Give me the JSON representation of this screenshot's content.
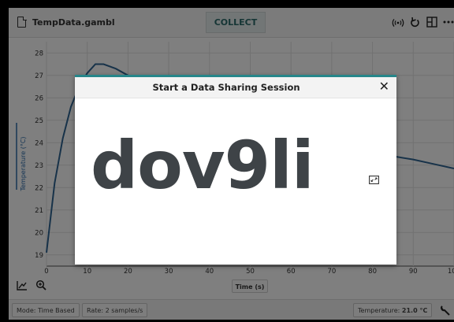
{
  "toolbar": {
    "file_name": "TempData.gambl",
    "collect_label": "COLLECT",
    "icons": [
      "file-icon",
      "wireless-icon",
      "undo-icon",
      "layout-icon",
      "more-icon"
    ]
  },
  "graph": {
    "xlabel": "Time (s)",
    "ylabel": "Temperature (°C)",
    "x_ticks": [
      "0",
      "10",
      "20",
      "30",
      "40",
      "50",
      "60",
      "70",
      "80",
      "90",
      "100"
    ],
    "y_ticks": [
      "19",
      "20",
      "21",
      "22",
      "23",
      "24",
      "25",
      "26",
      "27",
      "28"
    ],
    "line_color": "#2f6493"
  },
  "chart_data": {
    "type": "line",
    "title": "",
    "xlabel": "Time (s)",
    "ylabel": "Temperature (°C)",
    "xlim": [
      0,
      100
    ],
    "ylim": [
      18.5,
      28.5
    ],
    "grid": true,
    "series": [
      {
        "x": [
          0,
          2,
          4,
          6,
          8,
          10,
          12,
          14,
          17,
          20,
          85,
          90,
          95,
          100
        ],
        "y": [
          19.1,
          22.2,
          24.2,
          25.6,
          26.5,
          27.1,
          27.5,
          27.5,
          27.3,
          27.0,
          23.4,
          23.25,
          23.05,
          22.85
        ]
      }
    ]
  },
  "bottom": {
    "time_axis_label": "Time (s)",
    "icons": [
      "graph-tools-icon",
      "zoom-icon"
    ]
  },
  "status": {
    "mode_text": "Mode: Time Based",
    "rate_text": "Rate: 2 samples/s",
    "sensor_label": "Temperature: ",
    "sensor_value": "21.0 °C",
    "icons": [
      "wrench-icon"
    ]
  },
  "modal": {
    "title": "Start a Data Sharing Session",
    "close_glyph": "✕",
    "session_code": "dov9li",
    "icons": [
      "close-icon",
      "expand-icon"
    ],
    "accent_color": "#26868a"
  }
}
